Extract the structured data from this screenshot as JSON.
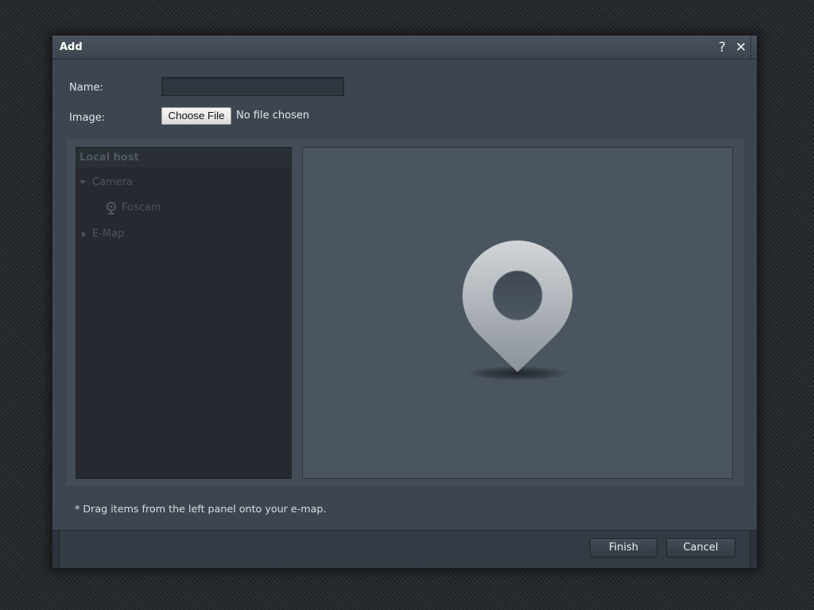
{
  "dialog": {
    "title": "Add",
    "help": {
      "icon": "help-icon",
      "glyph": "?"
    },
    "close": {
      "icon": "close-icon",
      "glyph": "✕"
    }
  },
  "form": {
    "name": {
      "label": "Name:",
      "value": ""
    },
    "image": {
      "label": "Image:",
      "button_label": "Choose File",
      "status": "No file chosen"
    }
  },
  "tree": {
    "header": "Local host",
    "items": [
      {
        "label": "Camera",
        "state": "expanded",
        "icon": "caret-down-icon",
        "children": [
          {
            "label": "Foscam",
            "icon": "camera-icon"
          }
        ]
      },
      {
        "label": "E-Map",
        "state": "collapsed",
        "icon": "caret-right-icon"
      }
    ]
  },
  "map": {
    "placeholder_icon": "map-pin-icon"
  },
  "note": "* Drag items from the left panel onto your e-map.",
  "footer": {
    "finish_label": "Finish",
    "cancel_label": "Cancel"
  },
  "colors": {
    "page_background": "#282c31",
    "dialog_body": "#3d4650",
    "tree_panel": "#262a30",
    "map_panel": "#4a5560",
    "pin": "#b4babf"
  }
}
